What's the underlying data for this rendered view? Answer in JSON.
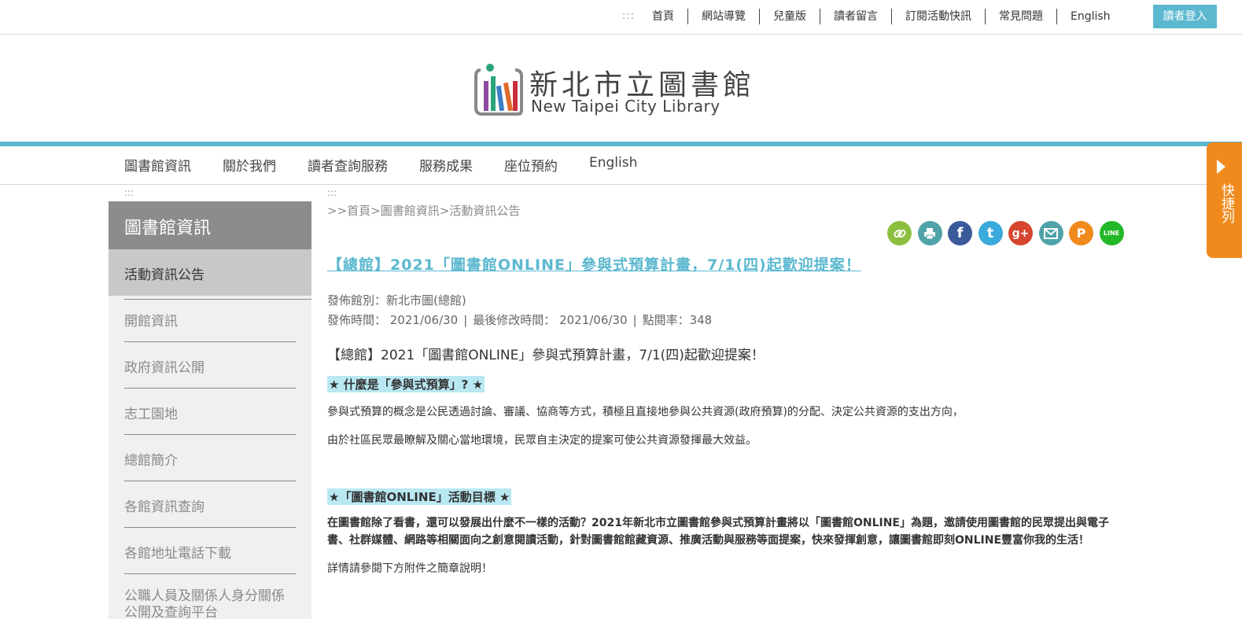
{
  "topbar": {
    "accesskey": ":::",
    "links": [
      "首頁",
      "網站導覽",
      "兒童版",
      "讀者留言",
      "訂閱活動快訊",
      "常見問題",
      "English"
    ],
    "login": "讀者登入"
  },
  "logo": {
    "zh": "新北市立圖書館",
    "en": "New Taipei City Library"
  },
  "mainnav": {
    "items": [
      "圖書館資訊",
      "關於我們",
      "讀者查詢服務",
      "服務成果",
      "座位預約",
      "English"
    ]
  },
  "quickbar": {
    "label": "快捷列"
  },
  "sidebar": {
    "accesskey": ":::",
    "heading": "圖書館資訊",
    "items": [
      "活動資訊公告",
      "開館資訊",
      "政府資訊公開",
      "志工園地",
      "總館簡介",
      "各館資訊查詢",
      "各館地址電話下載",
      "公職人員及關係人身分關係公開及查詢平台"
    ]
  },
  "content": {
    "accesskey": ":::",
    "breadcrumb": {
      "prefix": ">>",
      "home": "首頁",
      "sep": ">",
      "section": "圖書館資訊",
      "current": "活動資訊公告"
    },
    "share_icons": [
      "link-icon",
      "print-icon",
      "facebook-icon",
      "twitter-icon",
      "googleplus-icon",
      "email-icon",
      "plurk-icon",
      "line-icon"
    ],
    "title": "【總館】2021「圖書館ONLINE」參與式預算計畫，7/1(四)起歡迎提案！",
    "meta": {
      "branch": "發佈館別：新北市圖(總館)",
      "publish": "發佈時間： 2021/06/30",
      "modified": "最後修改時間： 2021/06/30",
      "views": "點閱率：348"
    },
    "lead": "【總館】2021「圖書館ONLINE」參與式預算計畫，7/1(四)起歡迎提案！",
    "h1": "★ 什麼是「參與式預算」? ★",
    "p1": "參與式預算的概念是公民透過討論、審議、協商等方式，積極且直接地參與公共資源(政府預算)的分配、決定公共資源的支出方向，",
    "p2": "由於社區民眾最瞭解及關心當地環境，民眾自主決定的提案可使公共資源發揮最大效益。",
    "h2": "★「圖書館ONLINE」活動目標 ★",
    "p3": "在圖書館除了看書，還可以發展出什麼不一樣的活動？2021年新北市立圖書館參與式預算計畫將以「圖書館ONLINE」為題，邀請使用圖書館的民眾提出與電子書、社群媒體、網路等相關面向之創意閱讀活動，針對圖書館館藏資源、推廣活動與服務等面提案，快來發揮創意，讓圖書館即刻ONLINE豐富你我的生活！",
    "p4": "詳情請參閱下方附件之簡章說明！"
  },
  "colors": {
    "accent": "#5bb8cf",
    "quickbar": "#f08a1d",
    "sidebar_head": "#8c8c8c"
  }
}
